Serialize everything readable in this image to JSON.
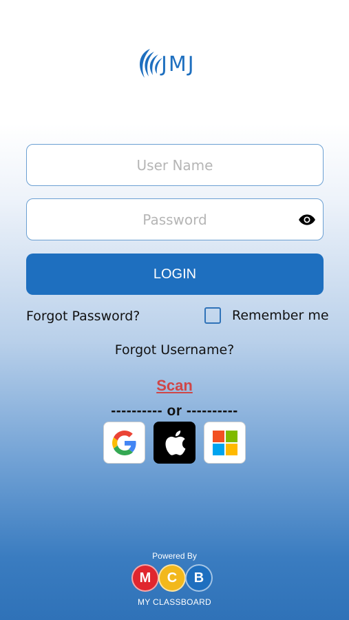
{
  "brand": {
    "logo_text": "JMJ",
    "color": "#1e6fbf"
  },
  "form": {
    "username": {
      "placeholder": "User Name",
      "value": ""
    },
    "password": {
      "placeholder": "Password",
      "value": ""
    },
    "login_label": "LOGIN",
    "forgot_password": "Forgot Password?",
    "remember_me": "Remember me",
    "remember_checked": false,
    "forgot_username": "Forgot Username?",
    "scan": "Scan",
    "or_divider": "---------- or ----------"
  },
  "social": [
    {
      "name": "google",
      "icon": "google-icon"
    },
    {
      "name": "apple",
      "icon": "apple-icon"
    },
    {
      "name": "microsoft",
      "icon": "microsoft-icon"
    }
  ],
  "footer": {
    "powered_by": "Powered By",
    "mcb_letters": [
      "M",
      "C",
      "B"
    ],
    "mcb_colors": [
      "#e0262e",
      "#f2b81c",
      "#1e6fbf"
    ],
    "caption": "MY CLASSBOARD"
  },
  "colors": {
    "accent": "#1e6fbf",
    "scan": "#cf4647"
  }
}
